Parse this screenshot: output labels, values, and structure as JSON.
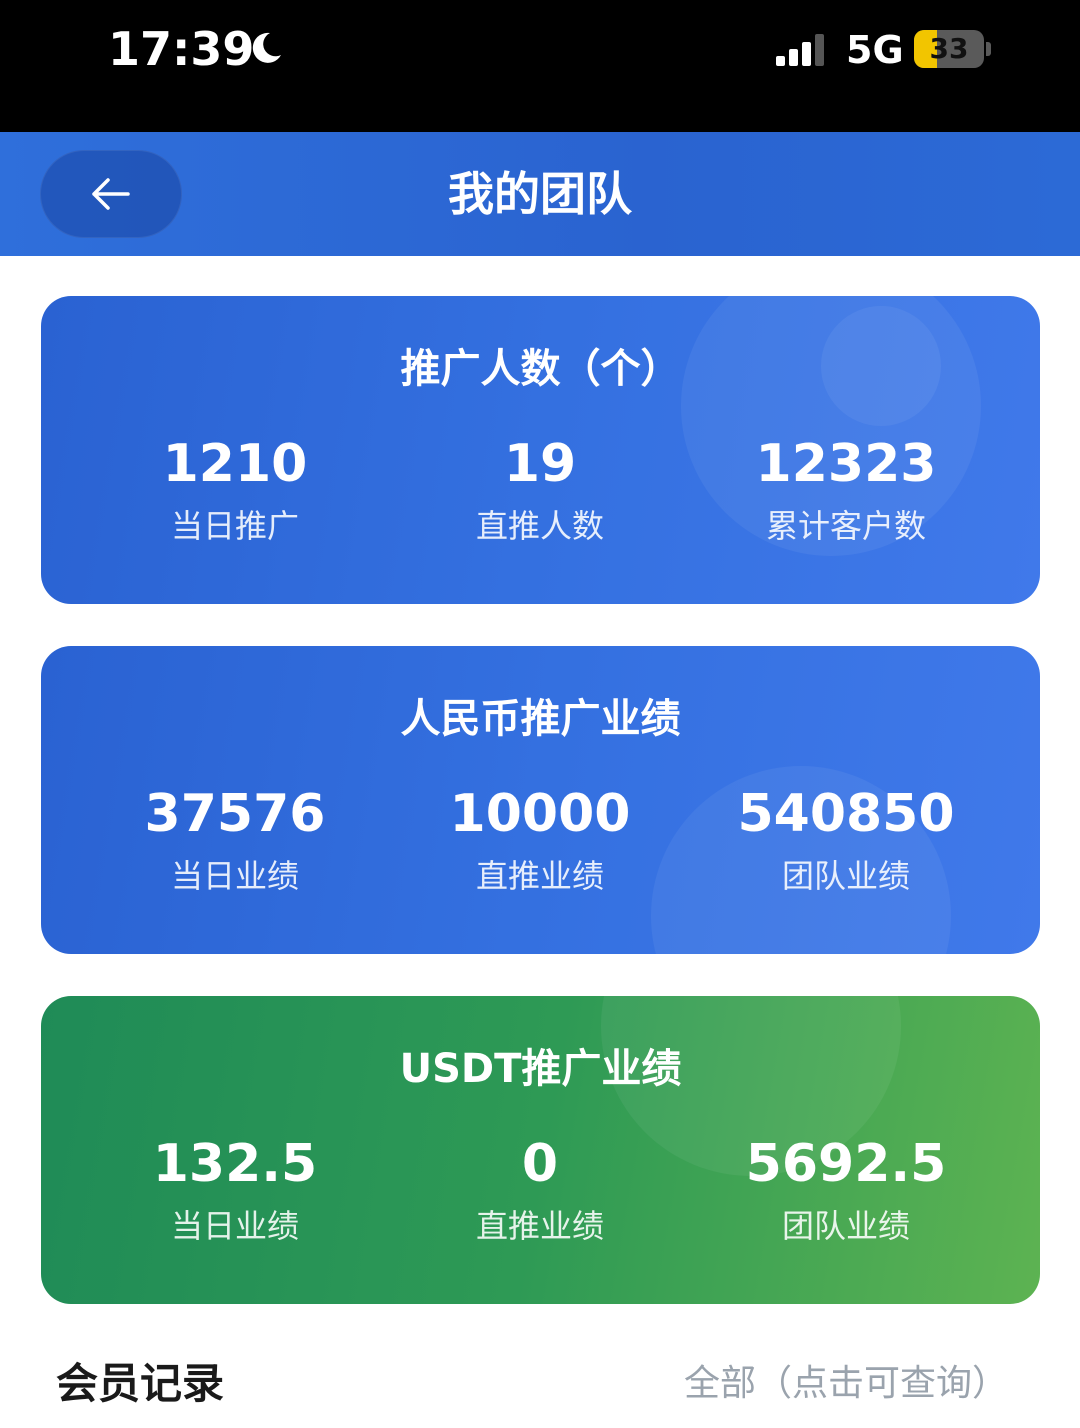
{
  "status_bar": {
    "time": "17:39",
    "network": "5G",
    "battery": "33",
    "battery_level": 0.33,
    "icons": [
      "moon-icon",
      "signal-icon",
      "battery-icon"
    ]
  },
  "header": {
    "title": "我的团队",
    "back_icon": "arrow-left-icon"
  },
  "cards": [
    {
      "title": "推广人数（个）",
      "theme": "#2f6bdc",
      "stats": [
        {
          "value": "1210",
          "label": "当日推广"
        },
        {
          "value": "19",
          "label": "直推人数"
        },
        {
          "value": "12323",
          "label": "累计客户数"
        }
      ]
    },
    {
      "title": "人民币推广业绩",
      "theme": "#2f6bdc",
      "stats": [
        {
          "value": "37576",
          "label": "当日业绩"
        },
        {
          "value": "10000",
          "label": "直推业绩"
        },
        {
          "value": "540850",
          "label": "团队业绩"
        }
      ]
    },
    {
      "title": "USDT推广业绩",
      "theme": "#2e9a55",
      "stats": [
        {
          "value": "132.5",
          "label": "当日业绩"
        },
        {
          "value": "0",
          "label": "直推业绩"
        },
        {
          "value": "5692.5",
          "label": "团队业绩"
        }
      ]
    }
  ],
  "records": {
    "title": "会员记录",
    "filter": "全部（点击可查询）"
  }
}
